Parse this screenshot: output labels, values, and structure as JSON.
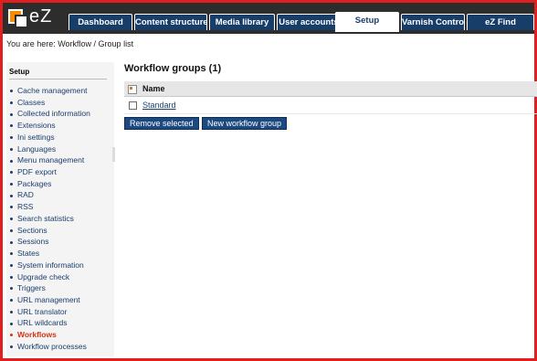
{
  "header": {
    "logo_text": "eZ",
    "tabs": [
      {
        "label": "Dashboard",
        "active": false
      },
      {
        "label": "Content structure",
        "active": false
      },
      {
        "label": "Media library",
        "active": false
      },
      {
        "label": "User accounts",
        "active": false
      },
      {
        "label": "Setup",
        "active": true
      },
      {
        "label": "Varnish Control",
        "active": false
      },
      {
        "label": "eZ Find",
        "active": false
      }
    ]
  },
  "breadcrumb": "You are here: Workflow / Group list",
  "sidebar": {
    "title": "Setup",
    "items": [
      {
        "label": "Cache management",
        "current": false
      },
      {
        "label": "Classes",
        "current": false
      },
      {
        "label": "Collected information",
        "current": false
      },
      {
        "label": "Extensions",
        "current": false
      },
      {
        "label": "Ini settings",
        "current": false
      },
      {
        "label": "Languages",
        "current": false
      },
      {
        "label": "Menu management",
        "current": false
      },
      {
        "label": "PDF export",
        "current": false
      },
      {
        "label": "Packages",
        "current": false
      },
      {
        "label": "RAD",
        "current": false
      },
      {
        "label": "RSS",
        "current": false
      },
      {
        "label": "Search statistics",
        "current": false
      },
      {
        "label": "Sections",
        "current": false
      },
      {
        "label": "Sessions",
        "current": false
      },
      {
        "label": "States",
        "current": false
      },
      {
        "label": "System information",
        "current": false
      },
      {
        "label": "Upgrade check",
        "current": false
      },
      {
        "label": "Triggers",
        "current": false
      },
      {
        "label": "URL management",
        "current": false
      },
      {
        "label": "URL translator",
        "current": false
      },
      {
        "label": "URL wildcards",
        "current": false
      },
      {
        "label": "Workflows",
        "current": true
      },
      {
        "label": "Workflow processes",
        "current": false
      }
    ]
  },
  "main": {
    "heading": "Workflow groups (1)",
    "table": {
      "columns": [
        "Name"
      ],
      "rows": [
        {
          "name": "Standard",
          "checked": false
        }
      ]
    },
    "buttons": {
      "remove_selected": "Remove selected",
      "new_group": "New workflow group"
    }
  },
  "colors": {
    "frame_border": "#e11f1f",
    "topbar_bg": "#2d2d2d",
    "tab_bg": "#173d69",
    "link": "#1c3d6e",
    "current_item": "#d4320f",
    "button_bg": "#1c4a80"
  }
}
